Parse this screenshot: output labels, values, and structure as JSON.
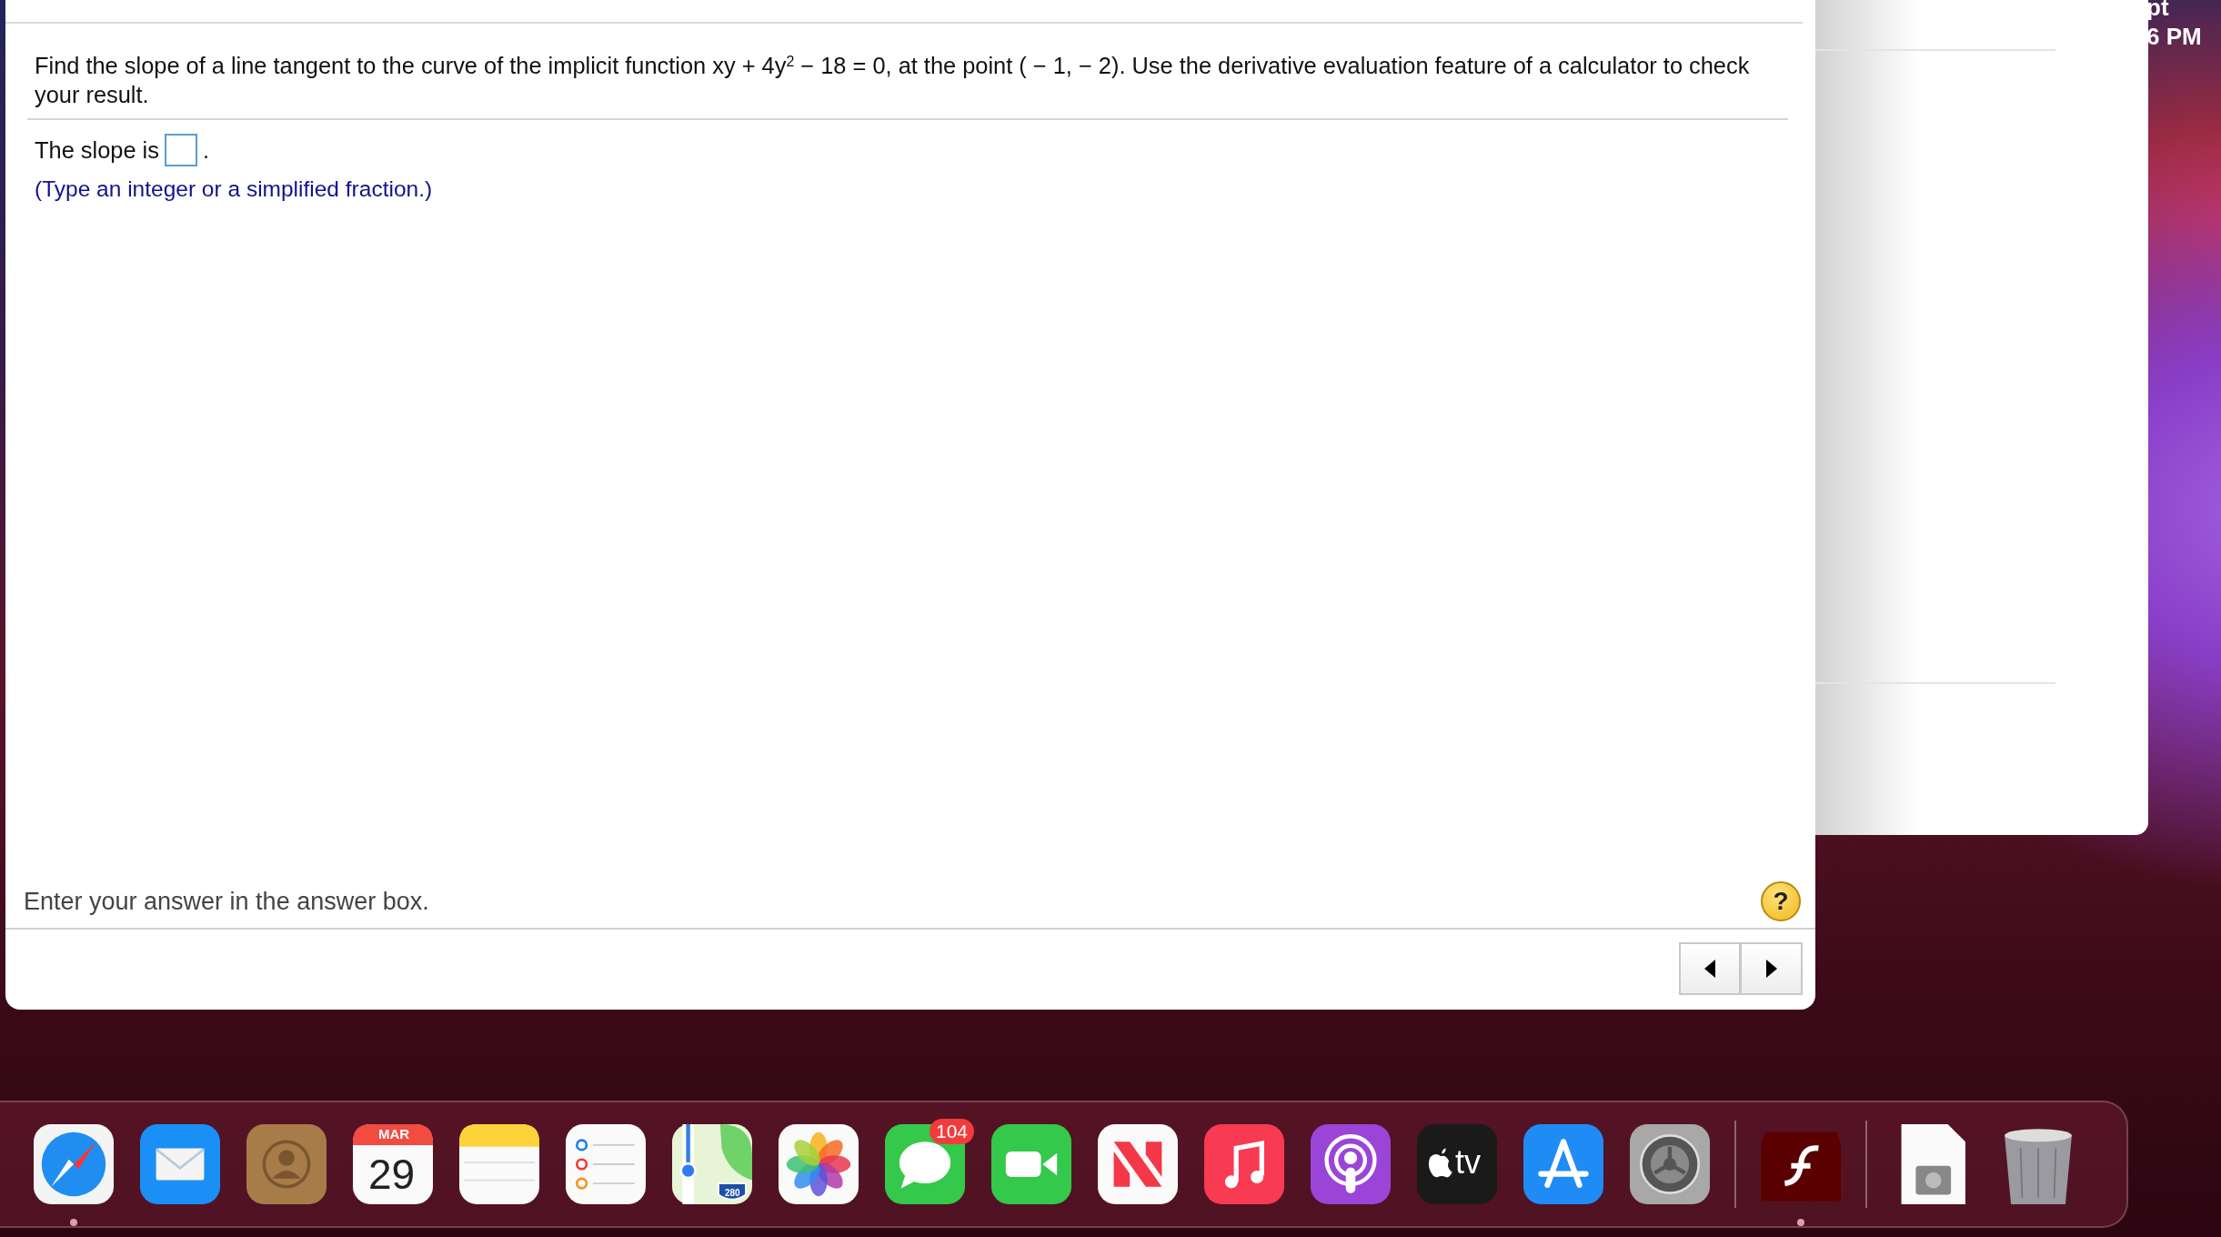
{
  "menu_bar": {
    "items": [
      "pt",
      "6 PM"
    ]
  },
  "question": {
    "text": "Find the slope of a line tangent to the curve of the implicit function xy + 4y$^{2}$ − 18 = 0, at the point ( − 1, − 2). Use the derivative evaluation feature of a calculator to check your result.",
    "answer_prefix": "The slope is",
    "answer_suffix": ".",
    "hint": "(Type an integer or a simplified fraction.)"
  },
  "footer": {
    "instruction": "Enter your answer in the answer box.",
    "help": "?"
  },
  "dock": {
    "items": [
      {
        "kind": "safari",
        "running": true
      },
      {
        "kind": "mail",
        "running": false
      },
      {
        "kind": "contacts",
        "running": false
      },
      {
        "kind": "calendar",
        "running": false,
        "month": "MAR",
        "day": "29"
      },
      {
        "kind": "notes",
        "running": false
      },
      {
        "kind": "reminders",
        "running": false
      },
      {
        "kind": "maps",
        "running": false,
        "shield": "280"
      },
      {
        "kind": "photos",
        "running": false
      },
      {
        "kind": "messages",
        "running": false,
        "badge": "104"
      },
      {
        "kind": "facetime",
        "running": false
      },
      {
        "kind": "news",
        "running": false
      },
      {
        "kind": "music",
        "running": false
      },
      {
        "kind": "podcasts",
        "running": false
      },
      {
        "kind": "tv",
        "running": false,
        "label": "tv"
      },
      {
        "kind": "appstore",
        "running": false
      },
      {
        "kind": "settings",
        "running": false
      },
      {
        "kind": "divider"
      },
      {
        "kind": "flash",
        "running": true
      },
      {
        "kind": "divider"
      },
      {
        "kind": "disk",
        "running": false
      },
      {
        "kind": "trash",
        "running": false
      }
    ]
  }
}
